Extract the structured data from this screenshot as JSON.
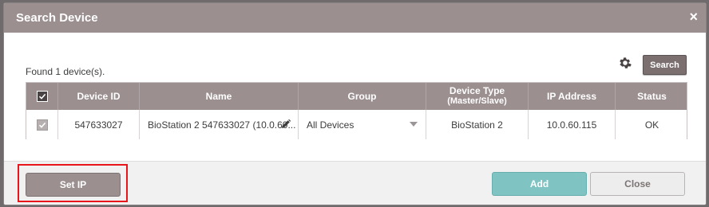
{
  "dialog": {
    "title": "Search Device",
    "close_icon": "×"
  },
  "found_text": "Found 1 device(s).",
  "toolbar": {
    "settings_icon": "gear-icon",
    "search_label": "Search"
  },
  "table": {
    "headers": {
      "device_id": "Device ID",
      "name": "Name",
      "group": "Group",
      "device_type_line1": "Device Type",
      "device_type_line2": "(Master/Slave)",
      "ip_address": "IP Address",
      "status": "Status"
    },
    "rows": [
      {
        "checked": true,
        "device_id": "547633027",
        "name": "BioStation 2 547633027 (10.0.60...",
        "group": "All Devices",
        "device_type": "BioStation 2",
        "ip_address": "10.0.60.115",
        "status": "OK"
      }
    ]
  },
  "footer": {
    "set_ip_label": "Set IP",
    "add_label": "Add",
    "close_label": "Close"
  },
  "colors": {
    "header_bg": "#9b8f90",
    "add_button": "#7fc4c3",
    "highlight": "#e8161b"
  }
}
